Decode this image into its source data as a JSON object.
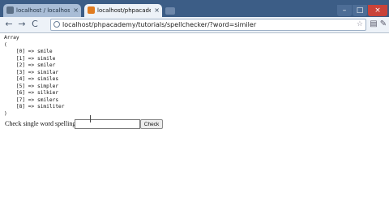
{
  "tabs": [
    {
      "title": "localhost / localhost / spell",
      "close": "×"
    },
    {
      "title": "localhost/phpacademy/tut",
      "close": "×"
    }
  ],
  "window_controls": {
    "minimize": "–",
    "maximize": "□",
    "close": "×"
  },
  "nav": {
    "back": "←",
    "forward": "→",
    "reload": "C"
  },
  "address_bar": {
    "url": "localhost/phpacademy/tutorials/spellchecker/?word=similer"
  },
  "page": {
    "array_dump": [
      "Array",
      "(",
      "    [0] => smile",
      "    [1] => simile",
      "    [2] => smiler",
      "    [3] => similar",
      "    [4] => similes",
      "    [5] => simpler",
      "    [6] => silkier",
      "    [7] => smilers",
      "    [8] => similiter",
      ")"
    ],
    "form_label": "Check single word spelling:",
    "input_value": "",
    "submit_label": "Check"
  }
}
